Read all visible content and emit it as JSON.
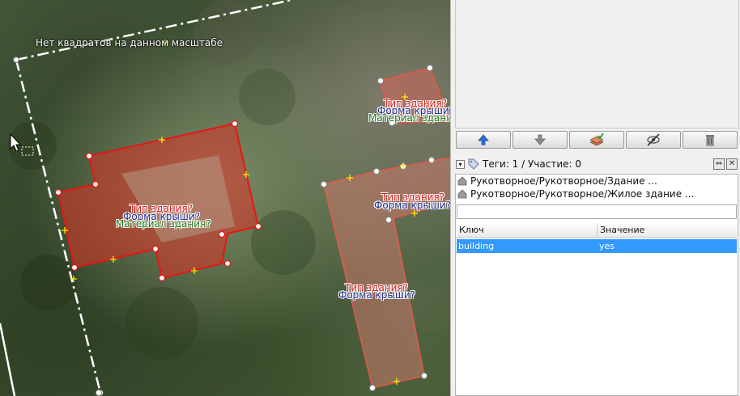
{
  "map": {
    "scale_message": "Нет квадратов на данном масштабе",
    "buildings": [
      {
        "type_label": "Тип здания?",
        "roof_label": "Форма крыши?",
        "material_label": "Материал здания?"
      },
      {
        "type_label": "Тип здания?",
        "roof_label": "Форма крыши?",
        "material_label": "Материал здания"
      },
      {
        "type_label": "Тип здания?",
        "roof_label": "Форма крыши?"
      },
      {
        "type_label": "Тип здания?",
        "roof_label": "Форма крыши?"
      }
    ],
    "colors": {
      "selected": "#e81515",
      "building": "#e8584a",
      "boundary": "#ffffff",
      "node_mark": "#ffee00"
    }
  },
  "toolbar": {
    "buttons": [
      {
        "name": "move-up",
        "icon": "arrow-up-icon"
      },
      {
        "name": "move-down",
        "icon": "arrow-down-icon"
      },
      {
        "name": "select-layers",
        "icon": "layers-check-icon"
      },
      {
        "name": "toggle-visibility",
        "icon": "eye-slash-icon"
      },
      {
        "name": "delete",
        "icon": "trash-icon"
      }
    ]
  },
  "tags_panel": {
    "header": "Теги: 1 / Участие: 0",
    "presets": [
      "Рукотворное/Рукотворное/Здание ...",
      "Рукотворное/Рукотворное/Жилое здание ..."
    ],
    "columns": {
      "key": "Ключ",
      "value": "Значение"
    },
    "rows": [
      {
        "key": "building",
        "value": "yes"
      }
    ],
    "selected_row_color": "#3399ff"
  }
}
